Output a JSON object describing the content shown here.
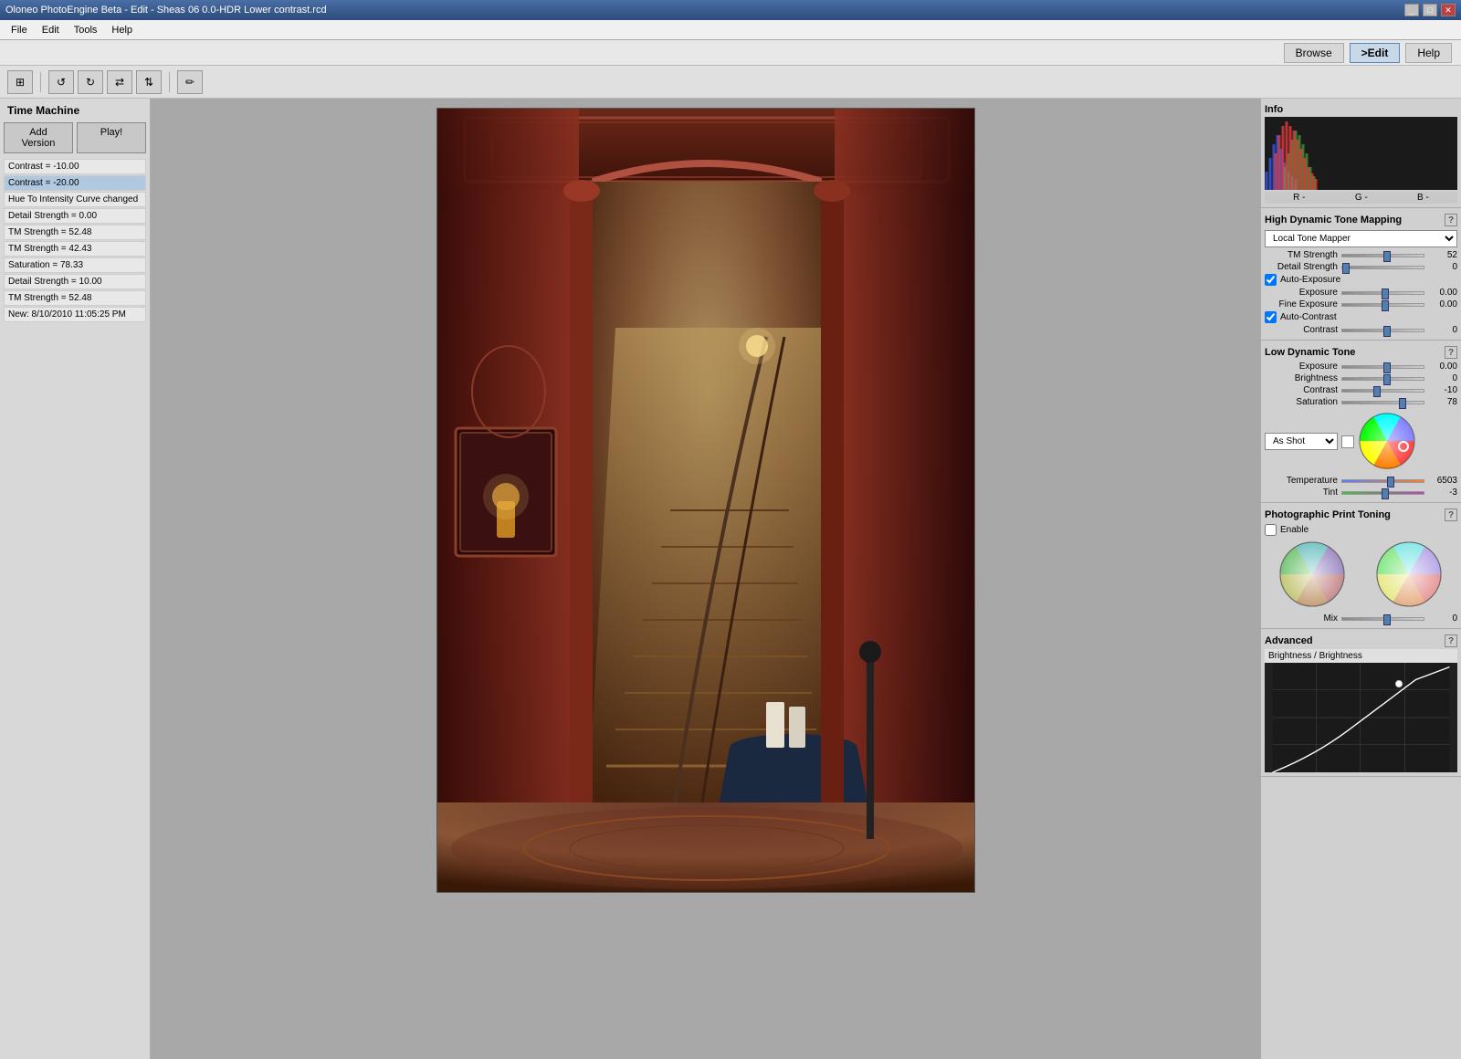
{
  "titlebar": {
    "title": "Oloneo PhotoEngine Beta - Edit - Sheas 06  0.0-HDR Lower contrast.rcd",
    "min_label": "_",
    "max_label": "□",
    "close_label": "✕"
  },
  "menubar": {
    "items": [
      {
        "label": "File"
      },
      {
        "label": "Edit"
      },
      {
        "label": "Tools"
      },
      {
        "label": "Help"
      }
    ]
  },
  "topnav": {
    "browse_label": "Browse",
    "edit_label": ">Edit",
    "help_label": "Help"
  },
  "toolbar": {
    "buttons": [
      {
        "icon": "⊞",
        "name": "fit-window"
      },
      {
        "icon": "↺",
        "name": "rotate-left"
      },
      {
        "icon": "↻",
        "name": "rotate-right"
      },
      {
        "icon": "⇄",
        "name": "flip-h"
      },
      {
        "icon": "⇅",
        "name": "flip-v"
      },
      {
        "icon": "✏",
        "name": "edit-tool"
      }
    ]
  },
  "time_machine": {
    "title": "Time Machine",
    "add_version_label": "Add Version",
    "play_label": "Play!",
    "history": [
      {
        "text": "Contrast = -10.00"
      },
      {
        "text": "Contrast = -20.00"
      },
      {
        "text": "Hue To Intensity Curve changed"
      },
      {
        "text": "Detail Strength = 0.00"
      },
      {
        "text": "TM Strength = 52.48"
      },
      {
        "text": "TM Strength = 42.43"
      },
      {
        "text": "Saturation = 78.33"
      },
      {
        "text": "Detail Strength = 10.00"
      },
      {
        "text": "TM Strength = 52.48"
      },
      {
        "text": "New: 8/10/2010 11:05:25 PM"
      }
    ]
  },
  "info": {
    "title": "Info",
    "hist_labels": [
      "R -",
      "G -",
      "B -"
    ]
  },
  "hdrtm": {
    "title": "High Dynamic Tone Mapping",
    "dropdown_options": [
      "Local Tone Mapper"
    ],
    "dropdown_selected": "Local Tone Mapper",
    "tm_strength_label": "TM Strength",
    "tm_strength_value": "52",
    "tm_strength_pct": 52,
    "detail_strength_label": "Detail Strength",
    "detail_strength_value": "0",
    "detail_strength_pct": 0,
    "auto_exposure_label": "Auto-Exposure",
    "auto_exposure_checked": true,
    "exposure_label": "Exposure",
    "exposure_value": "0.00",
    "exposure_pct": 50,
    "fine_exposure_label": "Fine Exposure",
    "fine_exposure_value": "0.00",
    "fine_exposure_pct": 50,
    "auto_contrast_label": "Auto-Contrast",
    "auto_contrast_checked": true,
    "contrast_label": "Contrast",
    "contrast_value": "0",
    "contrast_pct": 50
  },
  "lowdyn": {
    "title": "Low Dynamic Tone",
    "exposure_label": "Exposure",
    "exposure_value": "0.00",
    "exposure_pct": 50,
    "brightness_label": "Brightness",
    "brightness_value": "0",
    "brightness_pct": 50,
    "contrast_label": "Contrast",
    "contrast_value": "-10",
    "contrast_pct": 38,
    "saturation_label": "Saturation",
    "saturation_value": "78",
    "saturation_pct": 70,
    "color_mode_label": "As Shot",
    "temperature_label": "Temperature",
    "temperature_value": "6503",
    "temperature_pct": 55,
    "tint_label": "Tint",
    "tint_value": "-3",
    "tint_pct": 48
  },
  "print_toning": {
    "title": "Photographic Print Toning",
    "enable_label": "Enable",
    "enable_checked": false,
    "mix_label": "Mix",
    "mix_value": "0",
    "mix_pct": 50
  },
  "advanced": {
    "title": "Advanced",
    "curve_label": "Brightness / Brightness"
  }
}
